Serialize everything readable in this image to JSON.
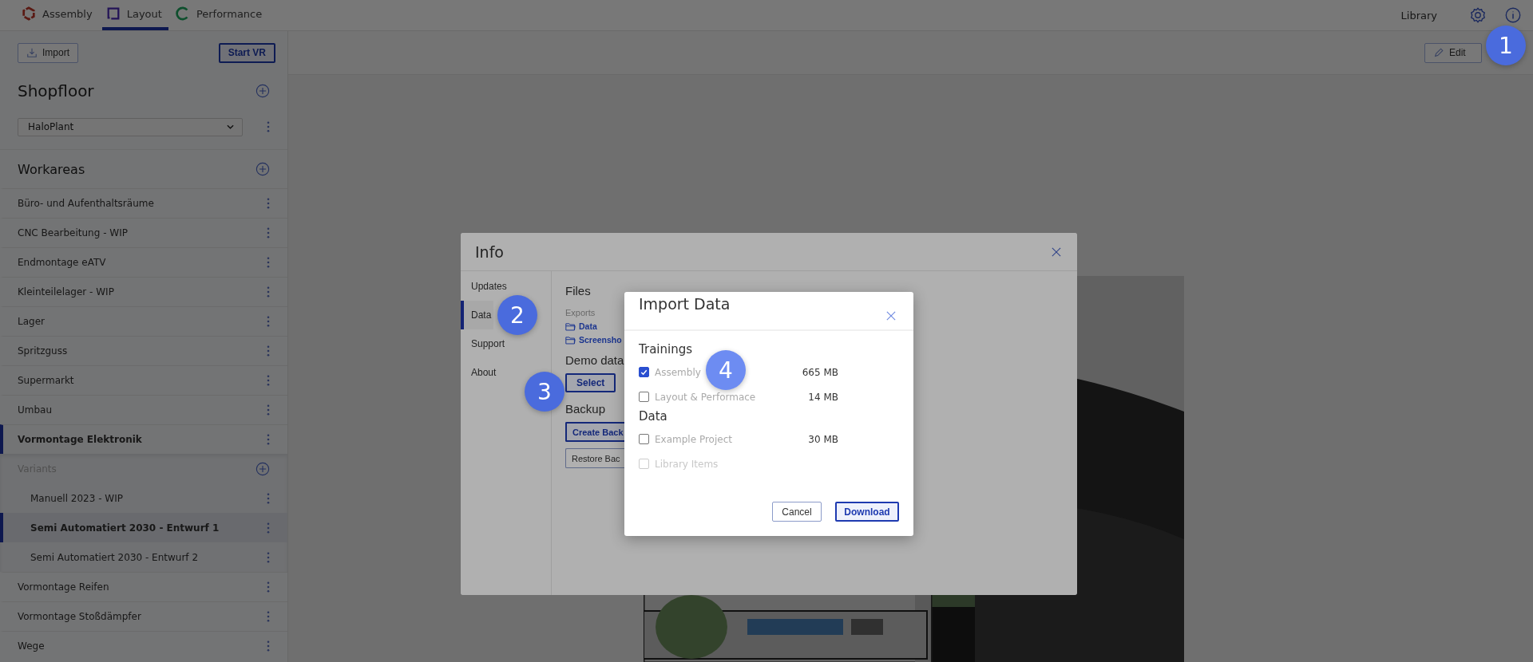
{
  "top_tabs": [
    {
      "label": "Assembly",
      "kind": "assembly",
      "selected": false
    },
    {
      "label": "Layout",
      "kind": "layout",
      "selected": true
    },
    {
      "label": "Performance",
      "kind": "performance",
      "selected": false
    }
  ],
  "top_right": {
    "library": "Library"
  },
  "toolbar": {
    "import": "Import",
    "start_vr": "Start VR",
    "edit": "Edit"
  },
  "sidebar": {
    "shopfloor_title": "Shopfloor",
    "shopfloor_select": "HaloPlant",
    "workareas_title": "Workareas",
    "workareas": [
      {
        "name": "Büro- und Aufenthaltsräume",
        "selected": false
      },
      {
        "name": "CNC Bearbeitung - WIP",
        "selected": false
      },
      {
        "name": "Endmontage eATV",
        "selected": false
      },
      {
        "name": "Kleinteilelager - WIP",
        "selected": false
      },
      {
        "name": "Lager",
        "selected": false
      },
      {
        "name": "Spritzguss",
        "selected": false
      },
      {
        "name": "Supermarkt",
        "selected": false
      },
      {
        "name": "Umbau",
        "selected": false
      },
      {
        "name": "Vormontage Elektronik",
        "selected": true,
        "variants_title": "Variants",
        "children": [
          {
            "name": "Manuell 2023 - WIP",
            "selected": false
          },
          {
            "name": "Semi Automatiert 2030 - Entwurf 1",
            "selected": true
          },
          {
            "name": "Semi Automatiert 2030 - Entwurf 2",
            "selected": false
          }
        ]
      },
      {
        "name": "Vormontage Reifen",
        "selected": false
      },
      {
        "name": "Vormontage Stoßdämpfer",
        "selected": false
      },
      {
        "name": "Wege",
        "selected": false
      }
    ]
  },
  "info_dialog": {
    "title": "Info",
    "nav": [
      {
        "label": "Updates",
        "selected": false
      },
      {
        "label": "Data",
        "selected": true
      },
      {
        "label": "Support",
        "selected": false
      },
      {
        "label": "About",
        "selected": false
      }
    ],
    "files_title": "Files",
    "exports_label": "Exports",
    "export_links": [
      "Data",
      "Screensho"
    ],
    "demo_title": "Demo data",
    "select_button": "Select",
    "backup_title": "Backup",
    "backup_buttons": [
      {
        "label": "Create Back",
        "primary": true
      },
      {
        "label": "Restore Bac",
        "primary": false
      }
    ]
  },
  "import_dialog": {
    "title": "Import Data",
    "groups": [
      {
        "title": "Trainings",
        "items": [
          {
            "label": "Assembly",
            "size": "665 MB",
            "checked": true,
            "disabled": false
          },
          {
            "label": "Layout & Performace",
            "size": "14 MB",
            "checked": false,
            "disabled": false
          }
        ]
      },
      {
        "title": "Data",
        "items": [
          {
            "label": "Example Project",
            "size": "30 MB",
            "checked": false,
            "disabled": false
          },
          {
            "label": "Library Items",
            "checked": false,
            "disabled": true
          }
        ]
      }
    ],
    "cancel": "Cancel",
    "download": "Download"
  },
  "step_badges": [
    "1",
    "2",
    "3",
    "4"
  ]
}
